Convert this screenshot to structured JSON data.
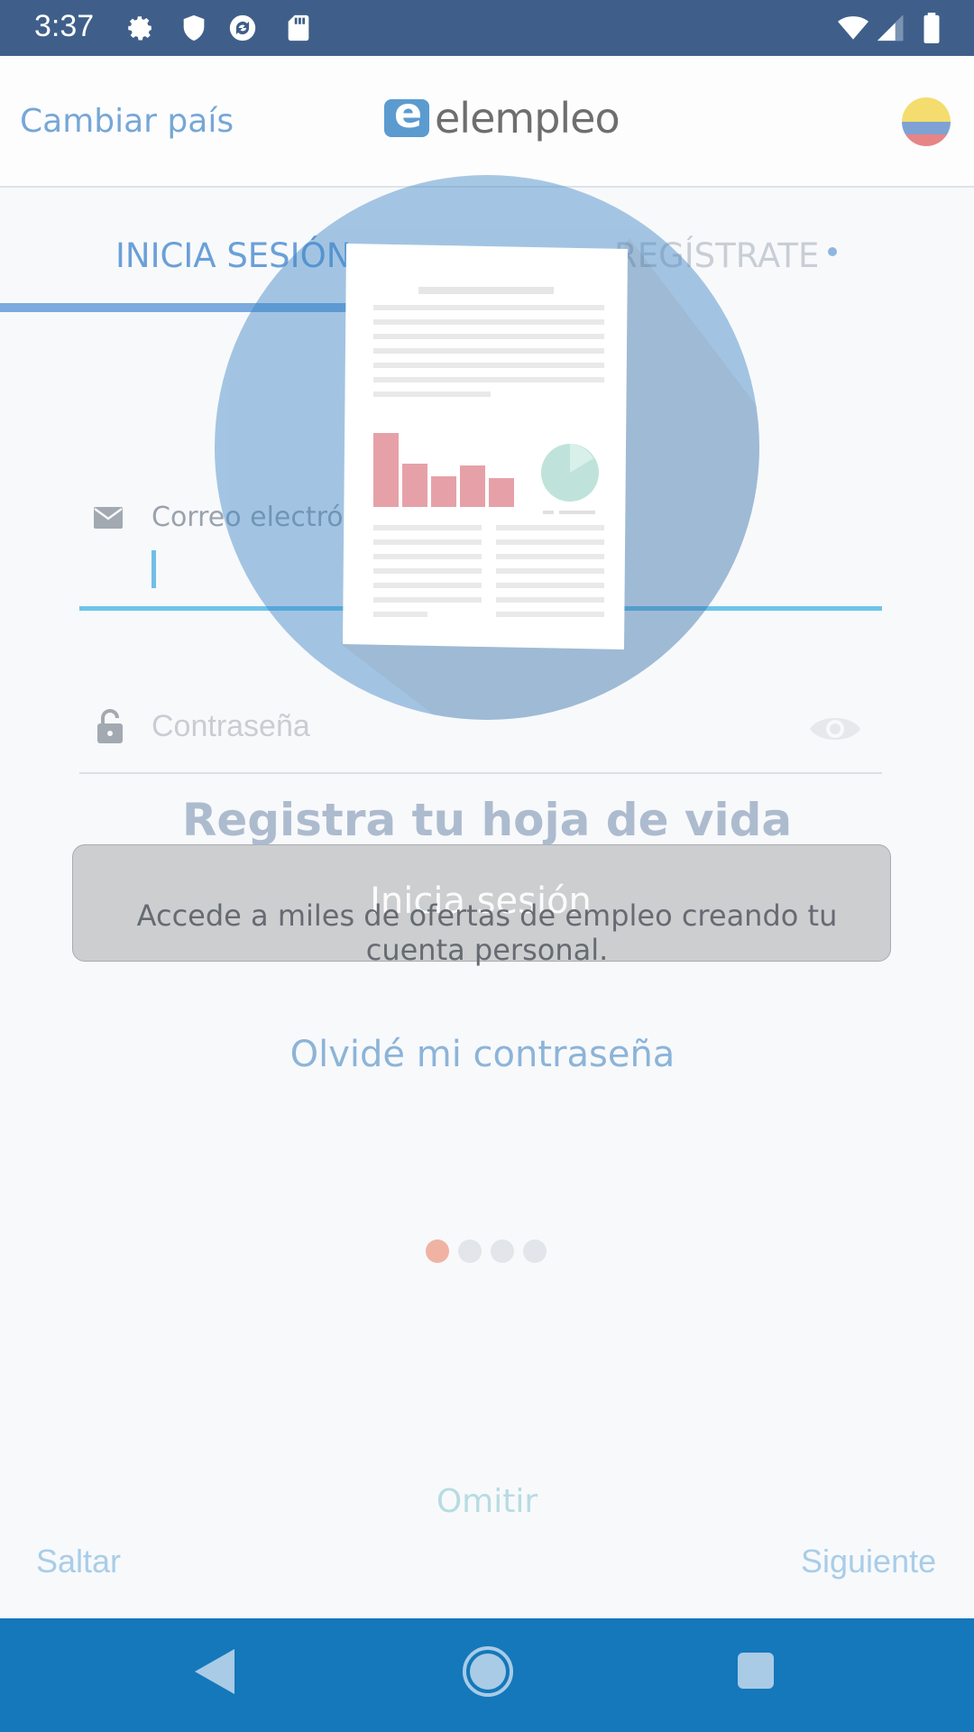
{
  "status_bar": {
    "time": "3:37",
    "left_icons": [
      "gear-icon",
      "shield-icon",
      "sync-icon",
      "sd-card-icon"
    ],
    "right_icons": [
      "wifi-icon",
      "signal-icon",
      "battery-icon"
    ]
  },
  "header": {
    "change_country": "Cambiar país",
    "logo_text": "elempleo",
    "flag": "colombia-flag"
  },
  "tabs": {
    "login": "INICIA SESIÓN",
    "register": "REGÍSTRATE"
  },
  "form": {
    "email_label": "Correo electrónico",
    "password_placeholder": "Contraseña",
    "login_button": "Inicia sesión",
    "forgot_password": "Olvidé mi contraseña"
  },
  "onboarding": {
    "title": "Registra tu hoja de vida",
    "description": "Accede a miles de ofertas de empleo creando tu cuenta personal.",
    "page_current": 1,
    "page_total": 4,
    "skip_center": "Omitir",
    "skip": "Saltar",
    "next": "Siguiente"
  },
  "colors": {
    "accent": "#6aa0d8",
    "status_bar": "#3f5f8a",
    "nav_bar": "#1478ba",
    "active_dot": "#f0b3a3"
  }
}
